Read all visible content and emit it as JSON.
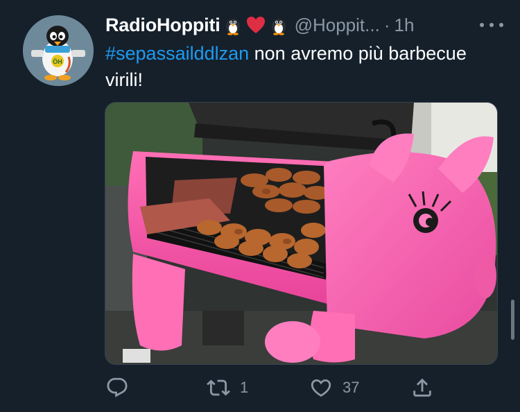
{
  "author": {
    "display_name": "RadioHoppiti",
    "name_emojis": [
      "penguin-emoji",
      "red-heart-emoji",
      "penguin-emoji"
    ],
    "handle": "@Hoppit...",
    "separator": "·",
    "time": "1h"
  },
  "tweet": {
    "hashtag": "#sepassailddlzan",
    "text": " non avremo più barbecue virili!"
  },
  "media": {
    "description_icon": "photo-of-pink-pig-shaped-barbecue-smoker-with-chicken-drumsticks"
  },
  "actions": {
    "reply_count": "",
    "retweet_count": "1",
    "like_count": "37"
  },
  "colors": {
    "background": "#15202b",
    "text": "#ffffff",
    "muted": "#8b98a5",
    "link": "#1d9bf0",
    "heart": "#f91880"
  }
}
